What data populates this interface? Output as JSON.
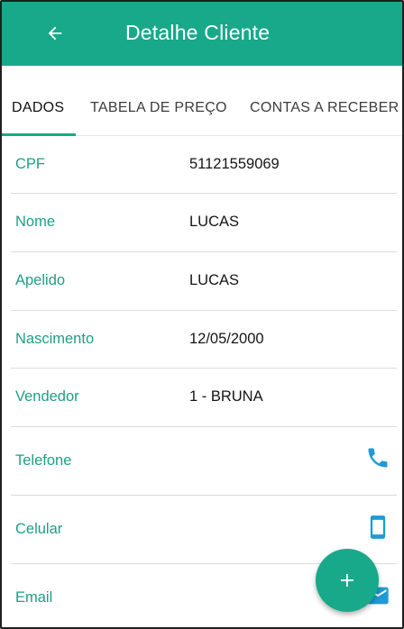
{
  "header": {
    "title": "Detalhe Cliente",
    "back_icon": "arrow-left-icon",
    "background_color": "#17a98a"
  },
  "tabs": [
    {
      "label": "DADOS",
      "active": true
    },
    {
      "label": "TABELA DE PREÇO",
      "active": false
    },
    {
      "label": "CONTAS A RECEBER",
      "active": false
    }
  ],
  "fields": [
    {
      "label": "CPF",
      "value": "51121559069"
    },
    {
      "label": "Nome",
      "value": "LUCAS"
    },
    {
      "label": "Apelido",
      "value": "LUCAS"
    },
    {
      "label": "Nascimento",
      "value": "12/05/2000"
    },
    {
      "label": "Vendedor",
      "value": "1 - BRUNA"
    }
  ],
  "contact_fields": [
    {
      "label": "Telefone",
      "icon": "phone-icon"
    },
    {
      "label": "Celular",
      "icon": "smartphone-icon"
    },
    {
      "label": "Email",
      "icon": "email-icon"
    }
  ],
  "fab": {
    "icon": "plus-icon"
  },
  "colors": {
    "accent": "#17a98a",
    "label_text": "#1f9e86",
    "icon_blue": "#1e9bd7"
  }
}
